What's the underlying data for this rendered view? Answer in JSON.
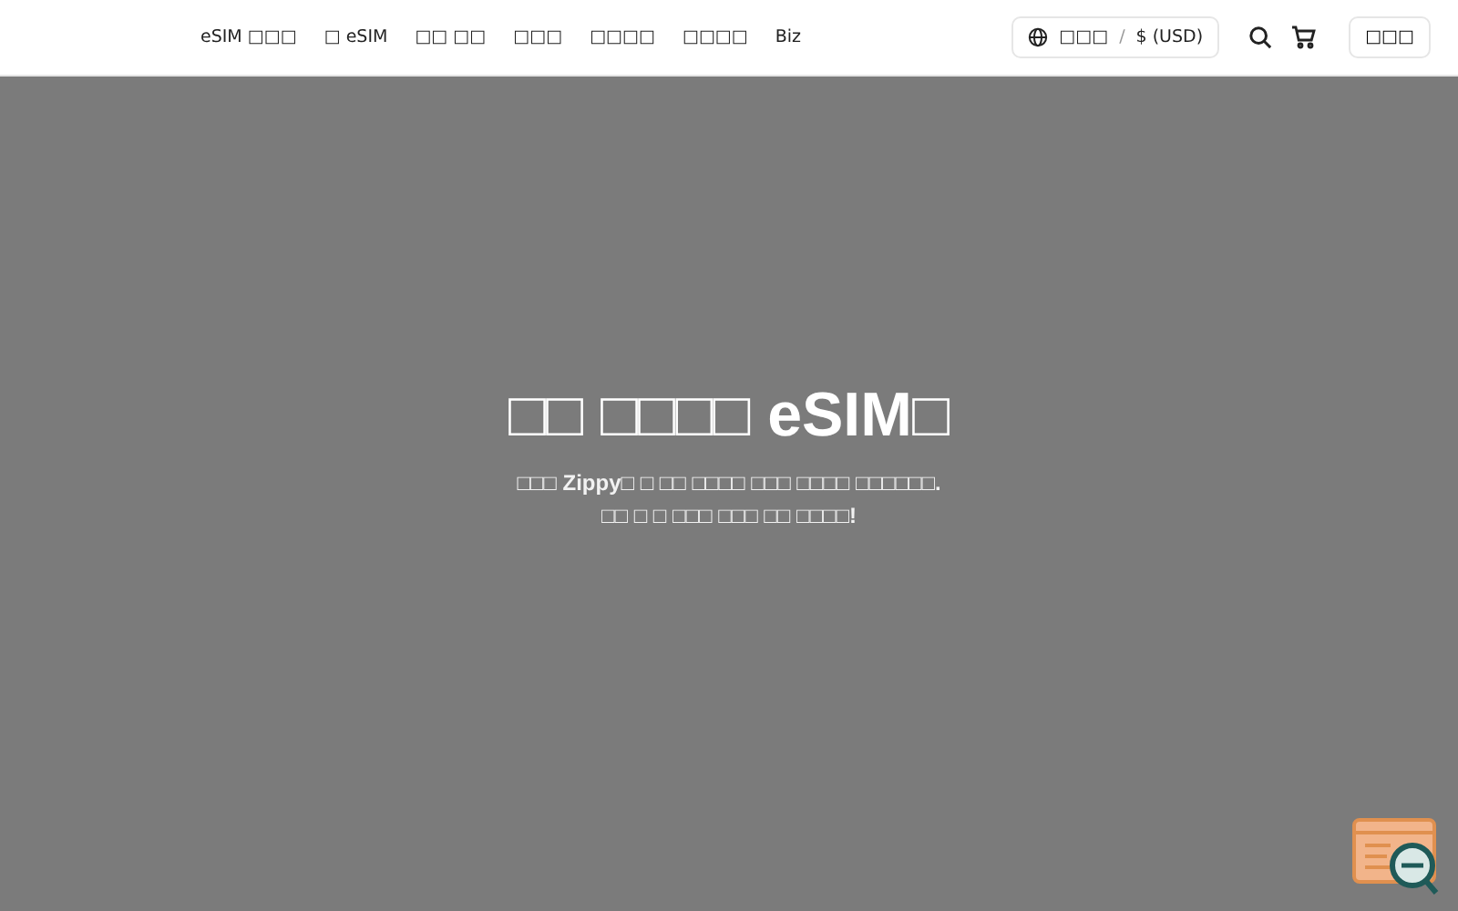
{
  "nav": {
    "links": [
      "eSIM □□□",
      "□ eSIM",
      "□□ □□",
      "□□□",
      "□□□□",
      "□□□□",
      "Biz"
    ],
    "language": "□□□",
    "separator": "/",
    "currency": "$ (USD)",
    "login": "□□□"
  },
  "hero": {
    "title": "□□ □□□□ eSIM□",
    "subtitle": [
      "□□□ Zippy□ □ □□ □□□□ □□□ □□□□ □□□□□□.",
      "□□ □ □ □□□ □□□ □□ □□□□!"
    ]
  }
}
